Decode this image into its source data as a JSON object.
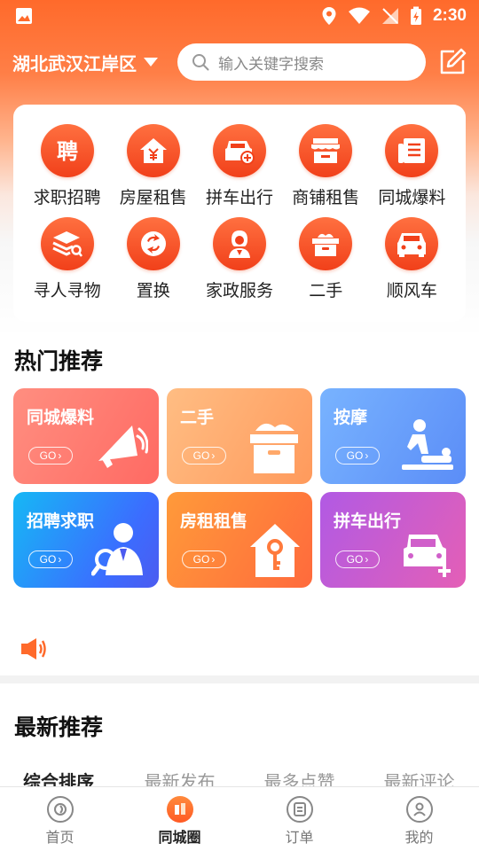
{
  "status": {
    "time": "2:30"
  },
  "header": {
    "location": "湖北武汉江岸区",
    "search_placeholder": "输入关键字搜索"
  },
  "categories": [
    {
      "label": "求职招聘",
      "icon": "hire-icon",
      "glyph": "聘"
    },
    {
      "label": "房屋租售",
      "icon": "house-yuan-icon",
      "glyph": ""
    },
    {
      "label": "拼车出行",
      "icon": "car-add-icon",
      "glyph": ""
    },
    {
      "label": "商铺租售",
      "icon": "shop-icon",
      "glyph": ""
    },
    {
      "label": "同城爆料",
      "icon": "news-icon",
      "glyph": ""
    },
    {
      "label": "寻人寻物",
      "icon": "layers-search-icon",
      "glyph": ""
    },
    {
      "label": "置换",
      "icon": "exchange-icon",
      "glyph": ""
    },
    {
      "label": "家政服务",
      "icon": "housekeeper-icon",
      "glyph": ""
    },
    {
      "label": "二手",
      "icon": "box-icon",
      "glyph": ""
    },
    {
      "label": "顺风车",
      "icon": "car-front-icon",
      "glyph": ""
    }
  ],
  "hot": {
    "title": "热门推荐",
    "go_label": "GO",
    "cards": [
      {
        "title": "同城爆料",
        "icon": "megaphone-icon"
      },
      {
        "title": "二手",
        "icon": "open-box-icon"
      },
      {
        "title": "按摩",
        "icon": "massage-icon"
      },
      {
        "title": "招聘求职",
        "icon": "recruiter-icon"
      },
      {
        "title": "房租租售",
        "icon": "house-key-icon"
      },
      {
        "title": "拼车出行",
        "icon": "car-plus-icon"
      }
    ]
  },
  "latest": {
    "title": "最新推荐",
    "tabs": [
      "综合排序",
      "最新发布",
      "最多点赞",
      "最新评论"
    ]
  },
  "nav": [
    {
      "label": "首页",
      "icon": "home-icon"
    },
    {
      "label": "同城圈",
      "icon": "city-circle-icon"
    },
    {
      "label": "订单",
      "icon": "order-icon"
    },
    {
      "label": "我的",
      "icon": "profile-icon"
    }
  ],
  "colors": {
    "brand": "#ff5a24",
    "active_text": "#222222",
    "inactive_text": "#999999"
  }
}
